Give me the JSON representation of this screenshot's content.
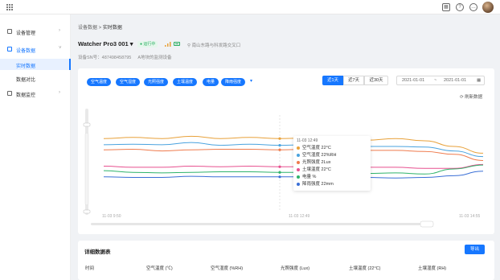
{
  "topbar": {
    "icons": [
      "grid-icon",
      "calendar-icon",
      "help-icon",
      "message-icon",
      "avatar"
    ]
  },
  "sidebar": {
    "items": [
      {
        "label": "设备管理",
        "icon": "device-icon"
      },
      {
        "label": "设备数据",
        "icon": "data-icon"
      },
      {
        "label": "数据监控",
        "icon": "monitor-icon"
      }
    ],
    "subitems": [
      {
        "label": "实时数据"
      },
      {
        "label": "数据对比"
      }
    ]
  },
  "breadcrumb": {
    "parent": "设备数据",
    "sep": " > ",
    "current": "实时数据"
  },
  "device": {
    "name": "Watcher Pro3 001 ▾",
    "status": "● 运行中",
    "location": "南山东路与科发路交叉口",
    "sn": "设备SN号：487498458795",
    "note": "A地块的监测设备"
  },
  "metric_tags": [
    "空气温度",
    "空气湿度",
    "光照强度",
    "土壤温度",
    "电量",
    "降雨强度"
  ],
  "ranges": [
    "近1天",
    "近7天",
    "近30天"
  ],
  "range_selected": "近1天",
  "date_start": "2021-01-01",
  "date_sep": "~",
  "date_end": "2021-01-01",
  "refresh_label": "⟳ 刷新数据",
  "colors": {
    "accent": "#1677ff",
    "running": "#27ae60"
  },
  "chart_data": {
    "type": "line",
    "x": [
      "11-03 9:50",
      "11-03 12:49",
      "11-03 14:55"
    ],
    "series": [
      {
        "name": "空气温度",
        "color": "#e8a13a",
        "values": [
          0.44,
          0.46,
          0.44,
          0.48,
          0.44,
          0.46,
          0.44,
          0.45,
          0.44,
          0.41,
          0.44,
          0.4,
          0.3,
          0.18
        ]
      },
      {
        "name": "空气湿度",
        "color": "#4aa3df",
        "values": [
          0.33,
          0.34,
          0.33,
          0.37,
          0.32,
          0.34,
          0.32,
          0.33,
          0.31,
          0.3,
          0.3,
          0.29,
          0.22,
          0.12
        ]
      },
      {
        "name": "光照强度",
        "color": "#ef7b4d",
        "values": [
          0.24,
          0.25,
          0.22,
          0.24,
          0.25,
          0.25,
          0.24,
          0.25,
          0.23,
          0.23,
          0.23,
          0.21,
          0.16,
          0.05
        ]
      },
      {
        "name": "土壤温度",
        "color": "#e7508f",
        "values": [
          -0.05,
          -0.07,
          -0.07,
          -0.05,
          -0.06,
          -0.05,
          -0.06,
          -0.06,
          -0.07,
          -0.07,
          -0.07,
          -0.09,
          -0.09,
          -0.02
        ]
      },
      {
        "name": "电量",
        "color": "#2fb36b",
        "values": [
          -0.13,
          -0.16,
          -0.17,
          -0.16,
          -0.15,
          -0.15,
          -0.16,
          -0.16,
          -0.17,
          -0.18,
          -0.17,
          -0.19,
          -0.1,
          -0.03
        ]
      },
      {
        "name": "降雨强度",
        "color": "#3a6fd6",
        "values": [
          -0.24,
          -0.25,
          -0.25,
          -0.23,
          -0.24,
          -0.24,
          -0.24,
          -0.24,
          -0.23,
          -0.25,
          -0.26,
          -0.25,
          -0.22,
          -0.14
        ]
      }
    ],
    "tooltip": {
      "time": "11-03 12:49",
      "rows": [
        "空气温度 22°C",
        "空气湿度 22%RH",
        "光照强度 2Lux",
        "土壤温度 22°C",
        "电量 %",
        "降雨强度 22mm"
      ]
    }
  },
  "table": {
    "title": "详细数据表",
    "export_label": "导出",
    "columns": [
      "时间",
      "空气温度 (℃)",
      "空气湿度 (%RH)",
      "光照强度 (Lux)",
      "土壤温度 (22°C)",
      "土壤湿度 (RH)"
    ]
  }
}
